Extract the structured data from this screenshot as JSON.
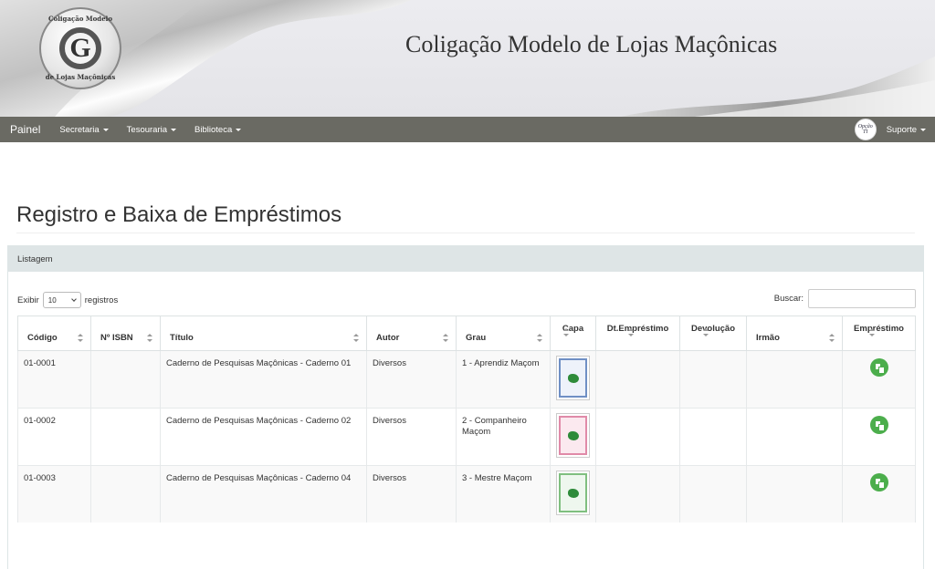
{
  "header": {
    "title": "Coligação Modelo de Lojas Maçônicas",
    "logo_text_top": "Coligação Modelo",
    "logo_text_bottom": "de Lojas Maçônicas",
    "logo_letter": "G"
  },
  "navbar": {
    "brand": "Painel",
    "items": [
      {
        "label": "Secretaria"
      },
      {
        "label": "Tesouraria"
      },
      {
        "label": "Biblioteca"
      }
    ],
    "user_menu": "Suporte",
    "avatar_text": "Opção TI"
  },
  "page": {
    "title": "Registro e Baixa de Empréstimos",
    "panel_title": "Listagem"
  },
  "listing": {
    "show_label": "Exibir",
    "page_size": "10",
    "records_label": "registros",
    "search_label": "Buscar:",
    "search_value": ""
  },
  "table": {
    "columns": [
      "Código",
      "Nº ISBN",
      "Título",
      "Autor",
      "Grau",
      "Capa",
      "Dt.Empréstimo",
      "Devolução",
      "Irmão",
      "Empréstimo"
    ],
    "rows": [
      {
        "codigo": "01-0001",
        "isbn": "",
        "titulo": "Caderno de Pesquisas Maçônicas - Caderno 01",
        "autor": "Diversos",
        "grau": "1 - Aprendiz Maçom",
        "dt_emprestimo": "",
        "devolucao": "",
        "irmao": "",
        "cover_color": "#6f8fc4"
      },
      {
        "codigo": "01-0002",
        "isbn": "",
        "titulo": "Caderno de Pesquisas Maçônicas - Caderno 02",
        "autor": "Diversos",
        "grau": "2 - Companheiro Maçom",
        "dt_emprestimo": "",
        "devolucao": "",
        "irmao": "",
        "cover_color": "#e08aa8"
      },
      {
        "codigo": "01-0003",
        "isbn": "",
        "titulo": "Caderno de Pesquisas Maçônicas - Caderno 04",
        "autor": "Diversos",
        "grau": "3 - Mestre Maçom",
        "dt_emprestimo": "",
        "devolucao": "",
        "irmao": "",
        "cover_color": "#7fbf7f"
      }
    ]
  },
  "icons": {
    "loan": "copy-icon",
    "cover": "book-cover-icon"
  },
  "colors": {
    "navbar": "#6a6a63",
    "panel_header": "#dee5e6",
    "loan_button": "#4cae4c"
  }
}
